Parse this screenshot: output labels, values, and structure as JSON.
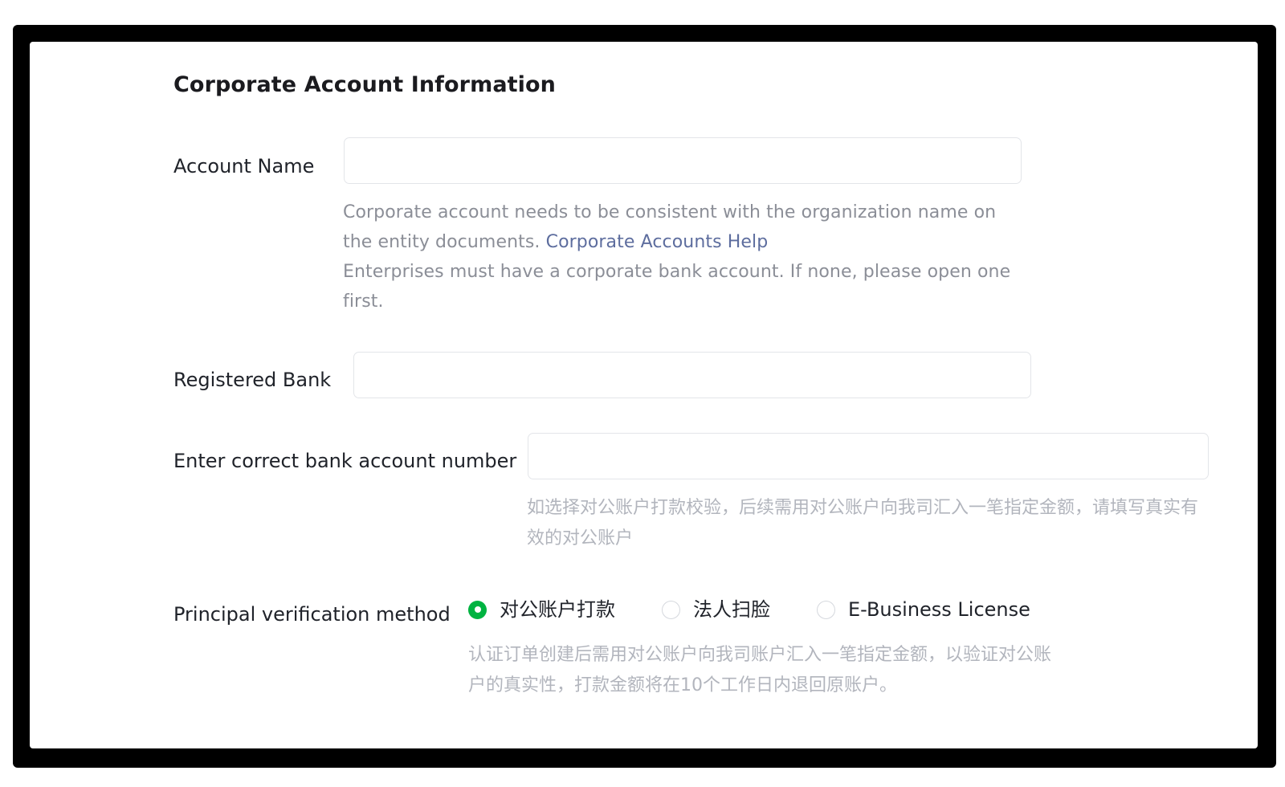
{
  "page": {
    "title": "Corporate Account Information"
  },
  "fields": {
    "account_name": {
      "label": "Account Name",
      "value": "",
      "placeholder": ""
    },
    "registered_bank": {
      "label": "Registered Bank",
      "value": "",
      "placeholder": ""
    },
    "bank_account_number": {
      "label": "Enter correct bank account number",
      "value": "",
      "placeholder": ""
    },
    "verification_method": {
      "label": "Principal verification method"
    }
  },
  "help": {
    "account_name_line1_before_link": "Corporate account needs to be consistent with the organization name on the entity documents. ",
    "account_name_link": "Corporate Accounts Help",
    "account_name_line2": "Enterprises must have a corporate bank account. If none, please open one first.",
    "bank_account_hint": "如选择对公账户打款校验，后续需用对公账户向我司汇入一笔指定金额，请填写真实有效的对公账户",
    "verification_description": "认证订单创建后需用对公账户向我司账户汇入一笔指定金额，以验证对公账户的真实性，打款金额将在10个工作日内退回原账户。"
  },
  "verification_options": [
    {
      "label": "对公账户打款",
      "selected": true
    },
    {
      "label": "法人扫脸",
      "selected": false
    },
    {
      "label": "E-Business License",
      "selected": false
    }
  ],
  "colors": {
    "accent_green": "#00b341",
    "link_blue": "#5d6d9e",
    "text_primary": "#20232a",
    "text_help": "#8b8e97",
    "text_hint": "#b2b5bd",
    "input_border": "#e3e5e9",
    "frame_black": "#000000"
  }
}
